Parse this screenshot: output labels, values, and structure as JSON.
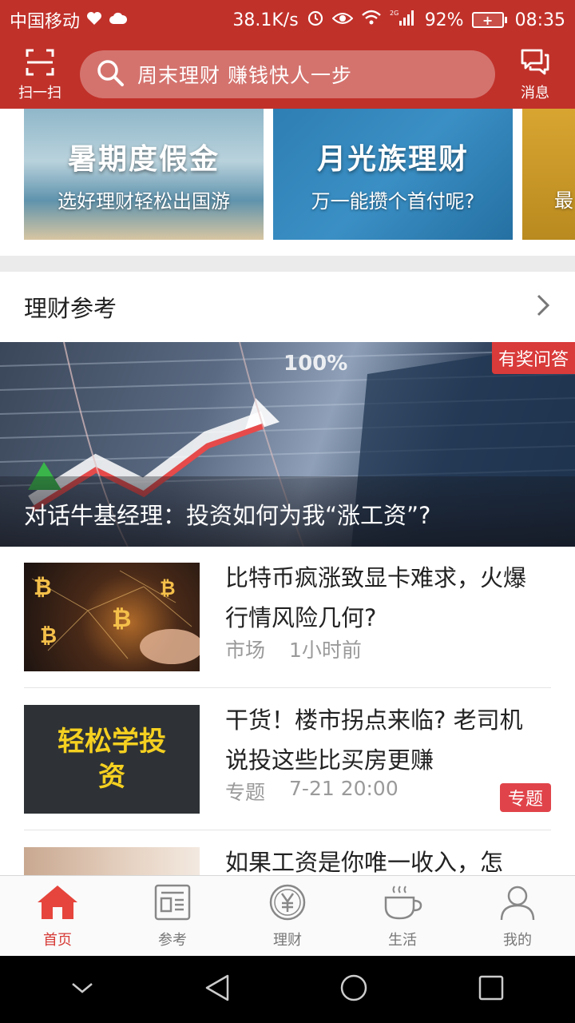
{
  "status_bar": {
    "carrier": "中国移动",
    "speed": "38.1K/s",
    "network": "2G",
    "battery": "92%",
    "time": "08:35"
  },
  "header": {
    "scan_label": "扫一扫",
    "search_placeholder": "周末理财 赚钱快人一步",
    "message_label": "消息"
  },
  "banners": [
    {
      "title": "暑期度假金",
      "subtitle": "选好理财轻松出国游"
    },
    {
      "title": "月光族理财",
      "subtitle": "万一能攒个首付呢?"
    },
    {
      "title": "",
      "subtitle": "最"
    }
  ],
  "section": {
    "title": "理财参考"
  },
  "hero": {
    "badge": "有奖问答",
    "caption": "对话牛基经理：投资如何为我“涨工资”?"
  },
  "articles": [
    {
      "title": "比特币疯涨致显卡难求，火爆行情风险几何?",
      "category": "市场",
      "time": "1小时前",
      "tag": ""
    },
    {
      "title": "干货！楼市拐点来临? 老司机说投这些比买房更赚",
      "category": "专题",
      "time": "7-21 20:00",
      "tag": "专题"
    },
    {
      "title": "如果工资是你唯一收入，怎",
      "category": "",
      "time": "",
      "tag": ""
    }
  ],
  "thumb_text": {
    "thumb2": "轻松学投资"
  },
  "bottom_nav": [
    {
      "label": "首页",
      "active": true
    },
    {
      "label": "参考",
      "active": false
    },
    {
      "label": "理财",
      "active": false
    },
    {
      "label": "生活",
      "active": false
    },
    {
      "label": "我的",
      "active": false
    }
  ],
  "colors": {
    "brand": "#c0312a",
    "active": "#d63a36",
    "tag": "#e0444a"
  }
}
